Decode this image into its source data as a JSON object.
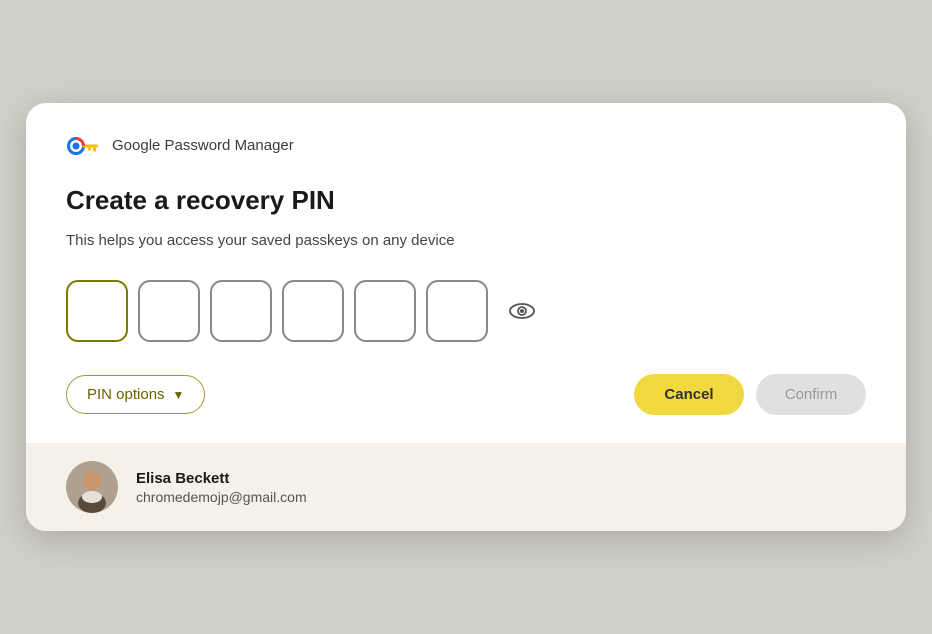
{
  "header": {
    "gpm_label": "Google Password Manager"
  },
  "dialog": {
    "title": "Create a recovery PIN",
    "description": "This helps you access your saved passkeys on any device",
    "pin_boxes": [
      "",
      "",
      "",
      "",
      "",
      ""
    ],
    "eye_label": "Toggle PIN visibility"
  },
  "actions": {
    "pin_options_label": "PIN options",
    "cancel_label": "Cancel",
    "confirm_label": "Confirm"
  },
  "footer": {
    "user_name": "Elisa Beckett",
    "user_email": "chromedemojp@gmail.com"
  },
  "icons": {
    "key": "🔑",
    "eye": "👁",
    "chevron_down": "▼"
  }
}
